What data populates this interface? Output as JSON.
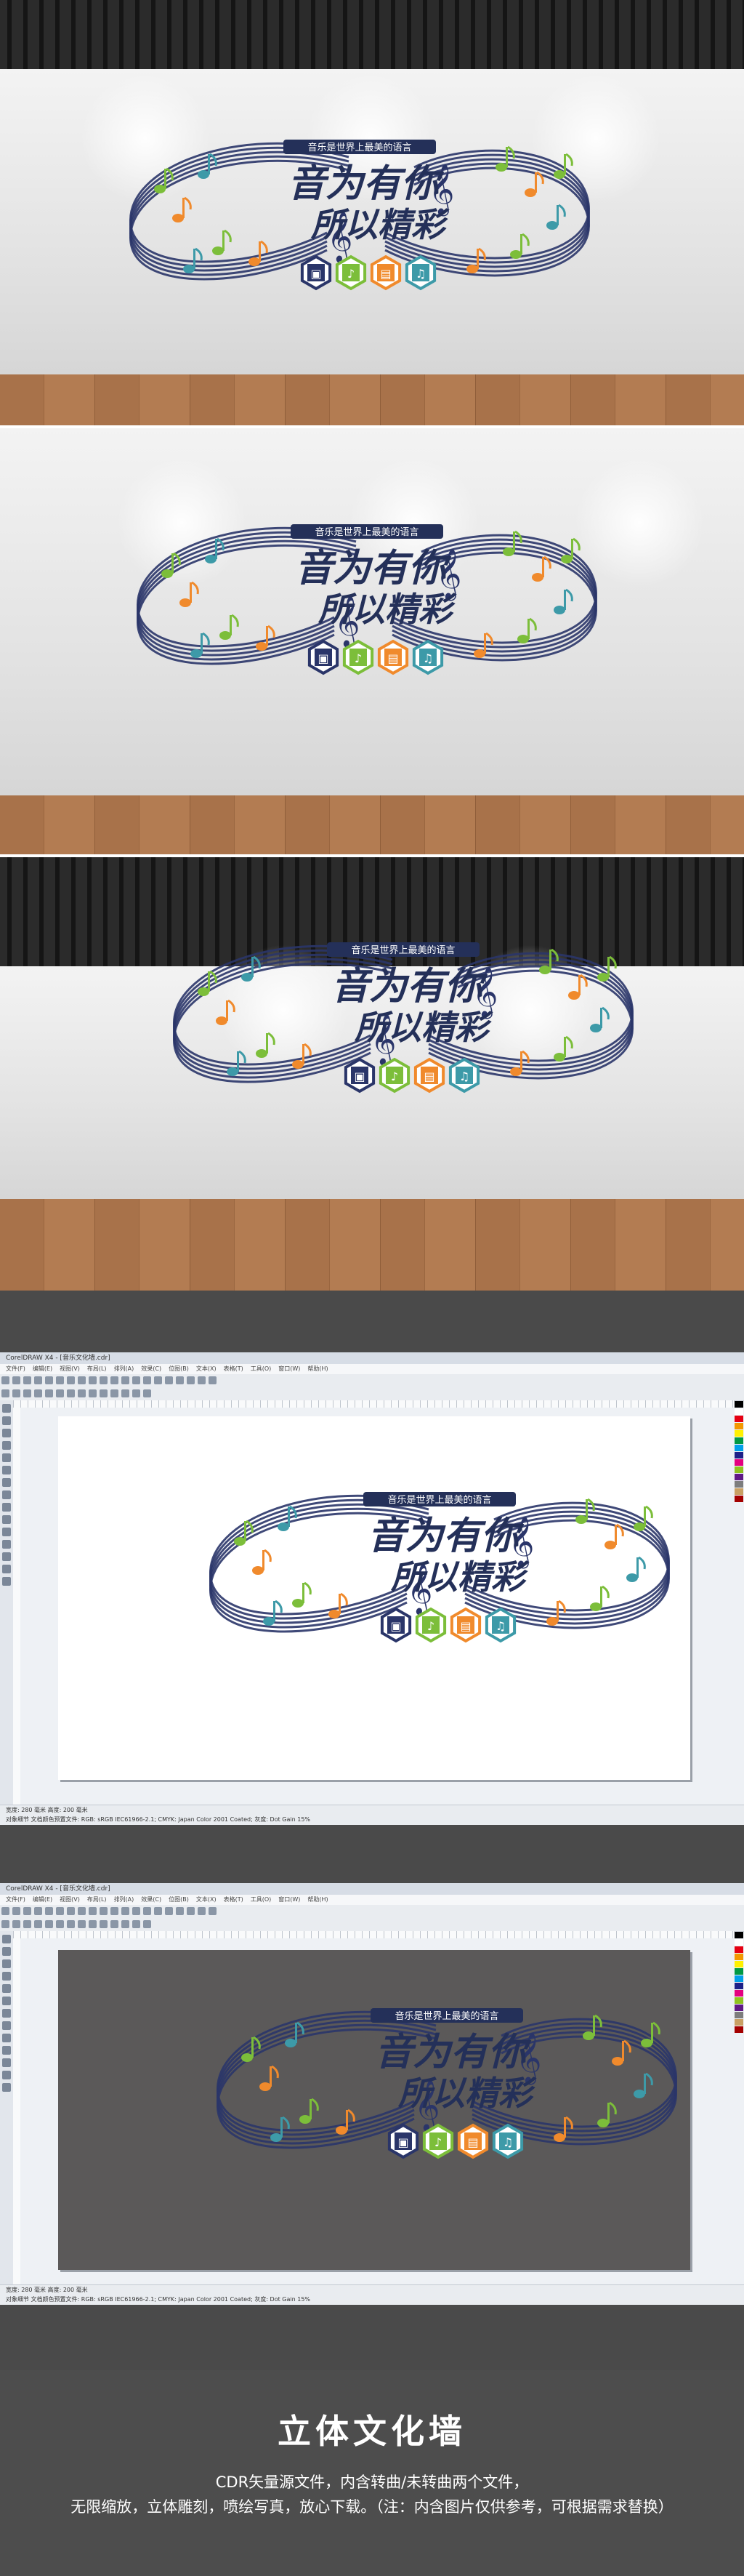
{
  "mural": {
    "slogan": "音乐是世界上最美的语言",
    "title_line1": "音为有你",
    "title_line2": "所以精彩",
    "instrument_icons": [
      "drum-kit-icon",
      "guitar-icon",
      "piano-icon",
      "trumpet-icon"
    ],
    "colors": {
      "navy": "#2a3569",
      "green": "#7cbe3a",
      "orange": "#f08a2c",
      "teal": "#3d9aa8",
      "dark": "#243059"
    }
  },
  "software": {
    "title_bar": "CorelDRAW X4 - [音乐文化墙.cdr]",
    "menu": [
      "文件(F)",
      "编辑(E)",
      "视图(V)",
      "布局(L)",
      "排列(A)",
      "效果(C)",
      "位图(B)",
      "文本(X)",
      "表格(T)",
      "工具(O)",
      "窗口(W)",
      "帮助(H)"
    ],
    "status_line1": "宽度: 280 毫米    高度: 200 毫米",
    "status_line2": "对象细节 文档颜色预置文件: RGB: sRGB IEC61966-2.1; CMYK: Japan Color 2001 Coated; 灰度: Dot Gain 15%",
    "palette": [
      "#000000",
      "#ffffff",
      "#e60012",
      "#f39800",
      "#fff100",
      "#009944",
      "#00a0e9",
      "#1d2088",
      "#e4007f",
      "#8fc31f",
      "#601986",
      "#7d7d7d",
      "#c9a063",
      "#a40000"
    ]
  },
  "footer": {
    "title": "立体文化墙",
    "line1": "CDR矢量源文件，内含转曲/未转曲两个文件，",
    "line2": "无限缩放，立体雕刻，喷绘写真，放心下载。（注：内含图片仅供参考，可根据需求替换）"
  }
}
